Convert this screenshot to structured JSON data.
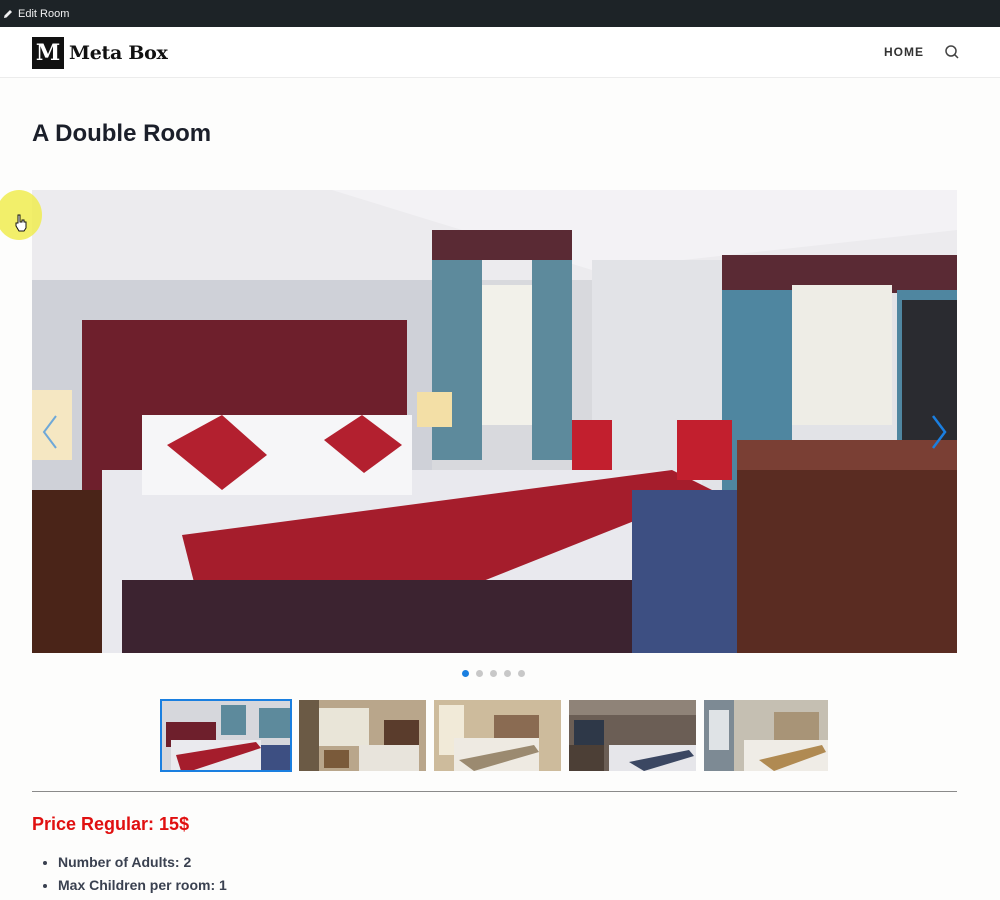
{
  "adminbar": {
    "edit_label": "Edit Room"
  },
  "header": {
    "logo_mark": "M",
    "logo_text": "Meta Box",
    "nav_home": "HOME"
  },
  "page": {
    "title": "A Double Room"
  },
  "gallery": {
    "slide_count": 5,
    "active_slide": 1,
    "thumbnails": [
      "thumb-1",
      "thumb-2",
      "thumb-3",
      "thumb-4",
      "thumb-5"
    ]
  },
  "details": {
    "price": "Price Regular: 15$",
    "features": [
      "Number of Adults: 2",
      "Max Children per room: 1"
    ]
  },
  "colors": {
    "accent": "#1a7fe0",
    "price": "#e01010",
    "adminbar": "#1d2327"
  }
}
